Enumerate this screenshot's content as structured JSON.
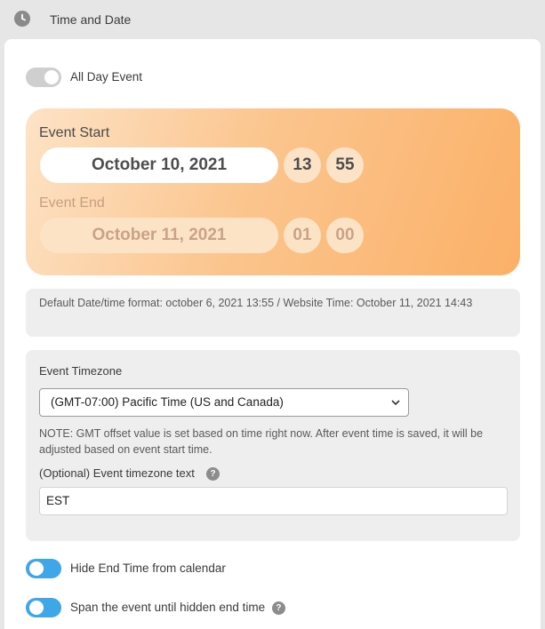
{
  "header": {
    "title": "Time and Date",
    "icon": "clock-icon"
  },
  "all_day": {
    "label": "All Day Event",
    "on": false
  },
  "event_start": {
    "label": "Event Start",
    "date": "October 10, 2021",
    "hour": "13",
    "minute": "55"
  },
  "event_end": {
    "label": "Event End",
    "date": "October 11, 2021",
    "hour": "01",
    "minute": "00"
  },
  "info": {
    "text": "Default Date/time format: october 6, 2021 13:55 / Website Time: October 11, 2021 14:43"
  },
  "timezone": {
    "label": "Event Timezone",
    "selected": "(GMT-07:00) Pacific Time (US and Canada)",
    "note": "NOTE: GMT offset value is set based on time right now. After event time is saved, it will be adjusted based on event start time.",
    "optional_label": "(Optional) Event timezone text",
    "optional_value": "EST"
  },
  "toggles": {
    "hide_end": {
      "label": "Hide End Time from calendar",
      "on": true
    },
    "span_event": {
      "label": "Span the event until hidden end time",
      "on": true
    }
  },
  "colors": {
    "accent_blue": "#3fa6e8",
    "gradient_start": "#fde3c6",
    "gradient_end": "#fbb067"
  }
}
